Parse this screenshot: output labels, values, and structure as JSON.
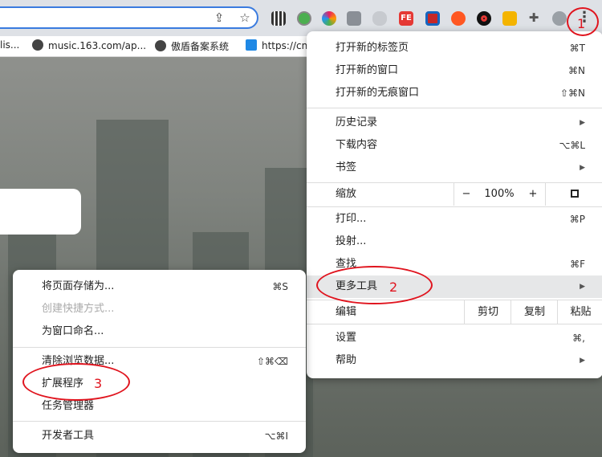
{
  "toolbar": {
    "extensions": [
      {
        "name": "qr-code-icon",
        "color": "#333333"
      },
      {
        "name": "green-dot-extension-icon",
        "color": "#4caf50"
      },
      {
        "name": "colorful-circle-extension-icon",
        "color": "#e040fb"
      },
      {
        "name": "grid-extension-icon",
        "color": "#8a8f96"
      },
      {
        "name": "cloud-extension-icon",
        "color": "#b0b4ba"
      },
      {
        "name": "fe-extension-icon",
        "color": "#e53935"
      },
      {
        "name": "translate-extension-icon",
        "color": "#c62828"
      },
      {
        "name": "lifebuoy-extension-icon",
        "color": "#ff5722"
      },
      {
        "name": "record-extension-icon",
        "color": "#111111"
      },
      {
        "name": "tiger-extension-icon",
        "color": "#f4b400"
      }
    ]
  },
  "bookmarks": [
    {
      "label": "lis..."
    },
    {
      "label": "music.163.com/ap..."
    },
    {
      "label": "傲盾备案系统"
    },
    {
      "label": "https://cn"
    }
  ],
  "main_menu": {
    "new_tab": {
      "label": "打开新的标签页",
      "shortcut": "⌘T"
    },
    "new_window": {
      "label": "打开新的窗口",
      "shortcut": "⌘N"
    },
    "new_incognito": {
      "label": "打开新的无痕窗口",
      "shortcut": "⇧⌘N"
    },
    "history": {
      "label": "历史记录"
    },
    "downloads": {
      "label": "下载内容",
      "shortcut": "⌥⌘L"
    },
    "bookmarks": {
      "label": "书签"
    },
    "zoom": {
      "label": "缩放",
      "minus": "−",
      "value": "100%",
      "plus": "+"
    },
    "print": {
      "label": "打印...",
      "shortcut": "⌘P"
    },
    "cast": {
      "label": "投射..."
    },
    "find": {
      "label": "查找",
      "shortcut": "⌘F"
    },
    "more_tools": {
      "label": "更多工具"
    },
    "edit": {
      "label": "编辑",
      "cut": "剪切",
      "copy": "复制",
      "paste": "粘贴"
    },
    "settings": {
      "label": "设置",
      "shortcut": "⌘,"
    },
    "help": {
      "label": "帮助"
    }
  },
  "sub_menu": {
    "save_page": {
      "label": "将页面存储为...",
      "shortcut": "⌘S"
    },
    "create_shortcut": {
      "label": "创建快捷方式..."
    },
    "name_window": {
      "label": "为窗口命名..."
    },
    "clear_data": {
      "label": "清除浏览数据...",
      "shortcut": "⇧⌘⌫"
    },
    "extensions": {
      "label": "扩展程序"
    },
    "task_manager": {
      "label": "任务管理器"
    },
    "developer_tools": {
      "label": "开发者工具",
      "shortcut": "⌥⌘I"
    }
  },
  "annotations": {
    "step1": "1",
    "step2": "2",
    "step3": "3",
    "color": "#e0141e"
  }
}
